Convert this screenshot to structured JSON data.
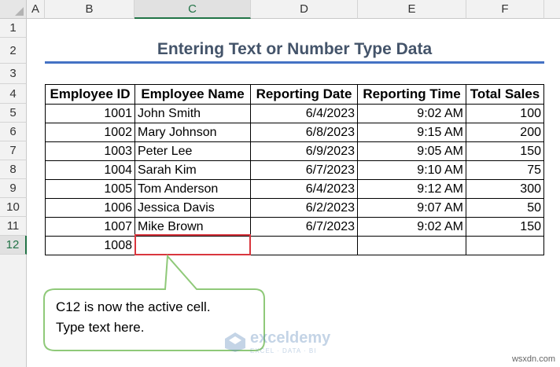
{
  "columns": [
    "A",
    "B",
    "C",
    "D",
    "E",
    "F"
  ],
  "rows": [
    "1",
    "2",
    "3",
    "4",
    "5",
    "6",
    "7",
    "8",
    "9",
    "10",
    "11",
    "12"
  ],
  "sheet_title": "Entering Text or Number Type Data",
  "table": {
    "headers": [
      "Employee ID",
      "Employee Name",
      "Reporting Date",
      "Reporting Time",
      "Total Sales"
    ],
    "rows": [
      [
        "1001",
        "John Smith",
        "6/4/2023",
        "9:02 AM",
        "100"
      ],
      [
        "1002",
        "Mary Johnson",
        "6/8/2023",
        "9:15 AM",
        "200"
      ],
      [
        "1003",
        "Peter Lee",
        "6/9/2023",
        "9:05 AM",
        "150"
      ],
      [
        "1004",
        "Sarah Kim",
        "6/7/2023",
        "9:10 AM",
        "75"
      ],
      [
        "1005",
        "Tom Anderson",
        "6/4/2023",
        "9:12 AM",
        "300"
      ],
      [
        "1006",
        "Jessica Davis",
        "6/2/2023",
        "9:07 AM",
        "50"
      ],
      [
        "1007",
        "Mike Brown",
        "6/7/2023",
        "9:02 AM",
        "150"
      ],
      [
        "1008",
        "",
        "",
        "",
        ""
      ]
    ]
  },
  "active_cell": "C12",
  "callout": {
    "line1": "C12 is now the active cell.",
    "line2": "Type text here."
  },
  "watermark": {
    "name": "exceldemy",
    "tagline": "EXCEL · DATA · BI",
    "icon": "exceldemy-logo-icon"
  },
  "site_tag": "wsxdn.com",
  "colors": {
    "selection_green": "#217346",
    "active_border": "#d9363e",
    "title_color": "#44546a",
    "title_rule": "#4472c4",
    "callout_border": "#8fc979"
  }
}
